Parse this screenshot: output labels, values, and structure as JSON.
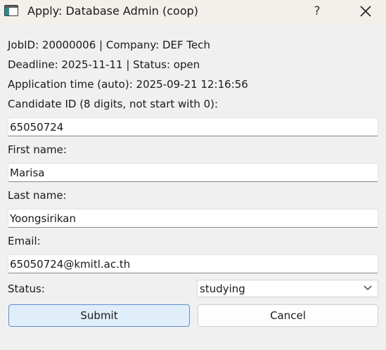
{
  "window": {
    "title": "Apply: Database Admin (coop)",
    "help_label": "?",
    "close_icon": "close-icon",
    "app_icon": "window-app-icon"
  },
  "info": {
    "job_line": "JobID: 20000006 | Company: DEF Tech",
    "deadline_line": "Deadline: 2025-11-11 | Status: open",
    "time_line": "Application time (auto): 2025-09-21 12:16:56"
  },
  "form": {
    "candidate_id_label": "Candidate ID (8 digits, not start with 0):",
    "candidate_id_value": "65050724",
    "first_name_label": "First name:",
    "first_name_value": "Marisa",
    "last_name_label": "Last name:",
    "last_name_value": "Yoongsirikan",
    "email_label": "Email:",
    "email_value": "65050724@kmitl.ac.th",
    "status_label": "Status:",
    "status_value": "studying"
  },
  "buttons": {
    "submit_label": "Submit",
    "cancel_label": "Cancel"
  },
  "colors": {
    "primary_button_fill": "#e0eef9",
    "primary_button_border": "#5a8fd0",
    "titlebar": "#f3efea",
    "background": "#f0f0f0"
  }
}
